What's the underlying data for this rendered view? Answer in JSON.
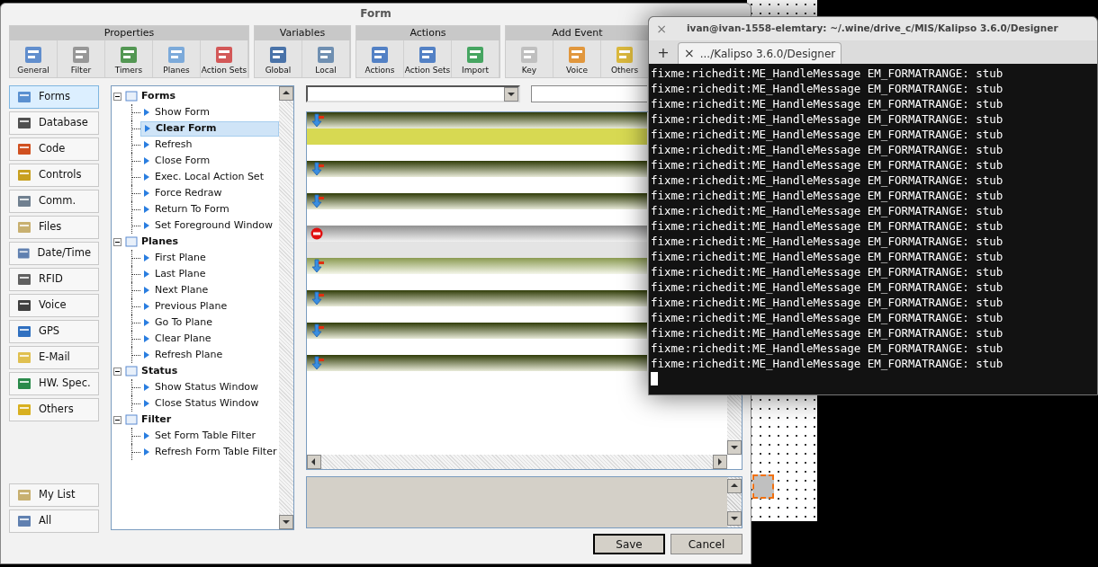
{
  "form_window": {
    "title": "Form",
    "toolbar": [
      {
        "title": "Properties",
        "buttons": [
          "General",
          "Filter",
          "Timers",
          "Planes",
          "Action Sets"
        ]
      },
      {
        "title": "Variables",
        "buttons": [
          "Global",
          "Local"
        ]
      },
      {
        "title": "Actions",
        "buttons": [
          "Actions",
          "Action Sets",
          "Import"
        ]
      },
      {
        "title": "Add Event",
        "buttons": [
          "Key",
          "Voice",
          "Others"
        ]
      }
    ],
    "sidebar": {
      "items": [
        {
          "label": "Forms",
          "selected": true
        },
        {
          "label": "Database",
          "selected": false
        },
        {
          "label": "Code",
          "selected": false
        },
        {
          "label": "Controls",
          "selected": false
        },
        {
          "label": "Comm.",
          "selected": false
        },
        {
          "label": "Files",
          "selected": false
        },
        {
          "label": "Date/Time",
          "selected": false
        },
        {
          "label": "RFID",
          "selected": false
        },
        {
          "label": "Voice",
          "selected": false
        },
        {
          "label": "GPS",
          "selected": false
        },
        {
          "label": "E-Mail",
          "selected": false
        },
        {
          "label": "HW. Spec.",
          "selected": false
        },
        {
          "label": "Others",
          "selected": false
        }
      ],
      "bottom_items": [
        {
          "label": "My List",
          "selected": false
        },
        {
          "label": "All",
          "selected": false
        }
      ]
    },
    "tree": [
      {
        "label": "Forms",
        "expanded": true,
        "children": [
          {
            "label": "Show Form",
            "selected": false
          },
          {
            "label": "Clear Form",
            "selected": true
          },
          {
            "label": "Refresh",
            "selected": false
          },
          {
            "label": "Close Form",
            "selected": false
          },
          {
            "label": "Exec. Local Action Set",
            "selected": false
          },
          {
            "label": "Force Redraw",
            "selected": false
          },
          {
            "label": "Return To Form",
            "selected": false
          },
          {
            "label": "Set Foreground Window",
            "selected": false
          }
        ]
      },
      {
        "label": "Planes",
        "expanded": true,
        "children": [
          {
            "label": "First Plane",
            "selected": false
          },
          {
            "label": "Last Plane",
            "selected": false
          },
          {
            "label": "Next Plane",
            "selected": false
          },
          {
            "label": "Previous Plane",
            "selected": false
          },
          {
            "label": "Go To Plane",
            "selected": false
          },
          {
            "label": "Clear Plane",
            "selected": false
          },
          {
            "label": "Refresh Plane",
            "selected": false
          }
        ]
      },
      {
        "label": "Status",
        "expanded": true,
        "children": [
          {
            "label": "Show Status Window",
            "selected": false
          },
          {
            "label": "Close Status Window",
            "selected": false
          }
        ]
      },
      {
        "label": "Filter",
        "expanded": true,
        "children": [
          {
            "label": "Set Form Table Filter",
            "selected": false
          },
          {
            "label": "Refresh Form Table Filter",
            "selected": false
          }
        ]
      }
    ],
    "action_rows": [
      {
        "kind": "action",
        "selected": true,
        "disabled": false
      },
      {
        "kind": "action",
        "selected": false,
        "disabled": false
      },
      {
        "kind": "action",
        "selected": false,
        "disabled": false
      },
      {
        "kind": "stop",
        "selected": false,
        "disabled": true
      },
      {
        "kind": "action",
        "selected": false,
        "disabled": false
      },
      {
        "kind": "action",
        "selected": false,
        "disabled": false
      },
      {
        "kind": "action",
        "selected": false,
        "disabled": false
      },
      {
        "kind": "action",
        "selected": false,
        "disabled": false
      }
    ],
    "buttons": [
      "Save",
      "Cancel"
    ]
  },
  "terminal": {
    "title": "ivan@ivan-1558-elemtary: ~/.wine/drive_c/MIS/Kalipso 3.6.0/Designer",
    "tab": ".../Kalipso 3.6.0/Designer",
    "close": "×",
    "new_tab": "+",
    "lines": [
      "fixme:richedit:ME_HandleMessage EM_FORMATRANGE: stub",
      "fixme:richedit:ME_HandleMessage EM_FORMATRANGE: stub",
      "fixme:richedit:ME_HandleMessage EM_FORMATRANGE: stub",
      "fixme:richedit:ME_HandleMessage EM_FORMATRANGE: stub",
      "fixme:richedit:ME_HandleMessage EM_FORMATRANGE: stub",
      "fixme:richedit:ME_HandleMessage EM_FORMATRANGE: stub",
      "fixme:richedit:ME_HandleMessage EM_FORMATRANGE: stub",
      "fixme:richedit:ME_HandleMessage EM_FORMATRANGE: stub",
      "fixme:richedit:ME_HandleMessage EM_FORMATRANGE: stub",
      "fixme:richedit:ME_HandleMessage EM_FORMATRANGE: stub",
      "fixme:richedit:ME_HandleMessage EM_FORMATRANGE: stub",
      "fixme:richedit:ME_HandleMessage EM_FORMATRANGE: stub",
      "fixme:richedit:ME_HandleMessage EM_FORMATRANGE: stub",
      "fixme:richedit:ME_HandleMessage EM_FORMATRANGE: stub",
      "fixme:richedit:ME_HandleMessage EM_FORMATRANGE: stub",
      "fixme:richedit:ME_HandleMessage EM_FORMATRANGE: stub",
      "fixme:richedit:ME_HandleMessage EM_FORMATRANGE: stub",
      "fixme:richedit:ME_HandleMessage EM_FORMATRANGE: stub",
      "fixme:richedit:ME_HandleMessage EM_FORMATRANGE: stub",
      "fixme:richedit:ME_HandleMessage EM_FORMATRANGE: stub"
    ]
  }
}
